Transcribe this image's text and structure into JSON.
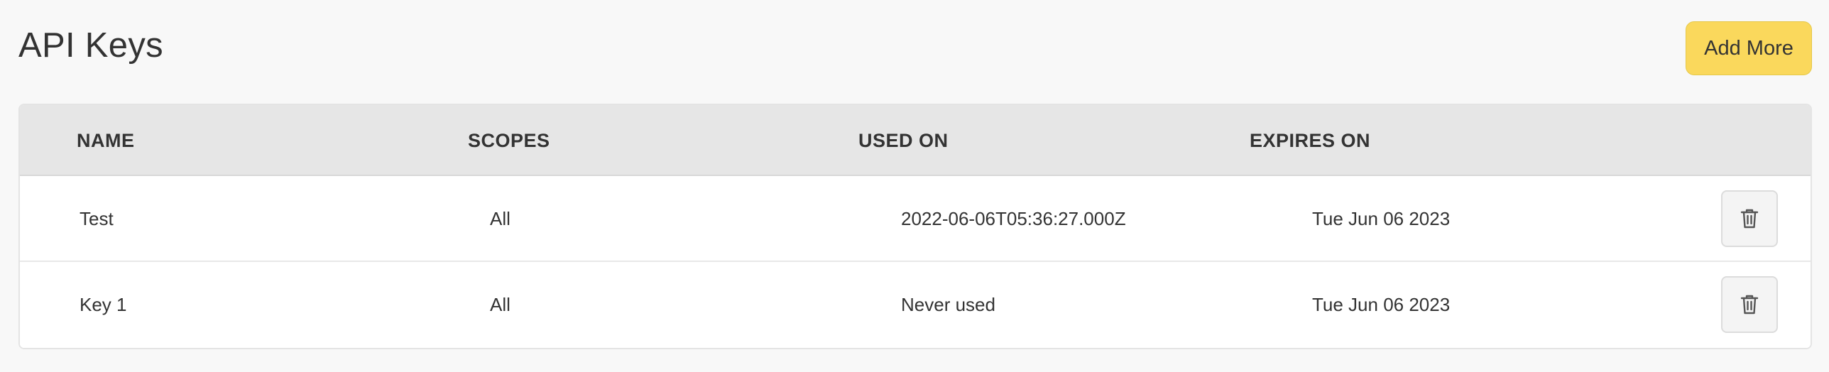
{
  "header": {
    "title": "API Keys",
    "add_label": "Add More"
  },
  "table": {
    "columns": [
      "NAME",
      "SCOPES",
      "USED ON",
      "EXPIRES ON"
    ],
    "rows": [
      {
        "name": "Test",
        "scopes": "All",
        "used_on": "2022-06-06T05:36:27.000Z",
        "expires_on": "Tue Jun 06 2023",
        "action_icon": "trash-icon"
      },
      {
        "name": "Key 1",
        "scopes": "All",
        "used_on": "Never used",
        "expires_on": "Tue Jun 06 2023",
        "action_icon": "trash-icon"
      }
    ]
  },
  "colors": {
    "accent": "#fad85c",
    "header_bg": "#e6e6e6",
    "page_bg": "#f8f8f8"
  }
}
